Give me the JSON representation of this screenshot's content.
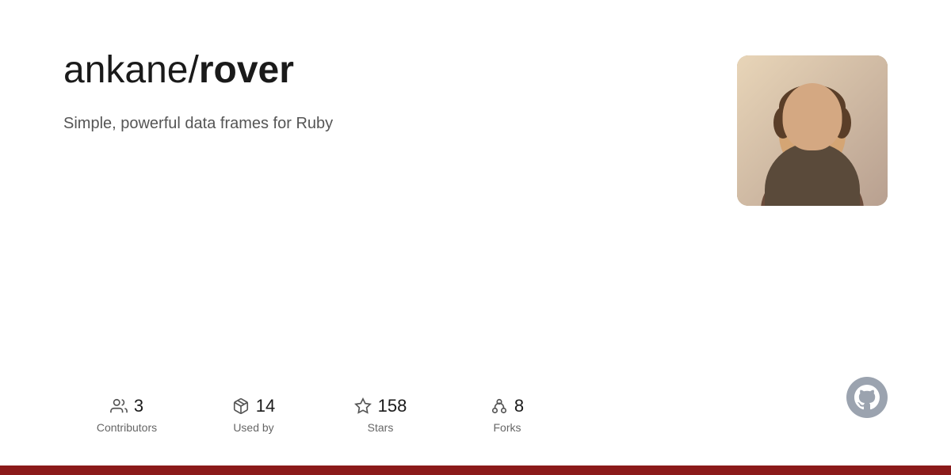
{
  "repo": {
    "owner": "ankane/",
    "name": "rover",
    "description": "Simple, powerful data frames for Ruby"
  },
  "stats": [
    {
      "id": "contributors",
      "number": "3",
      "label": "Contributors",
      "icon": "contributors-icon"
    },
    {
      "id": "used-by",
      "number": "14",
      "label": "Used by",
      "icon": "package-icon"
    },
    {
      "id": "stars",
      "number": "158",
      "label": "Stars",
      "icon": "star-icon"
    },
    {
      "id": "forks",
      "number": "8",
      "label": "Forks",
      "icon": "fork-icon"
    }
  ],
  "colors": {
    "bottom_bar": "#8b1a1a",
    "text_primary": "#1a1a1a",
    "text_secondary": "#555555",
    "text_muted": "#666666",
    "icon_color": "#555555",
    "github_bg": "#9ba3af"
  }
}
